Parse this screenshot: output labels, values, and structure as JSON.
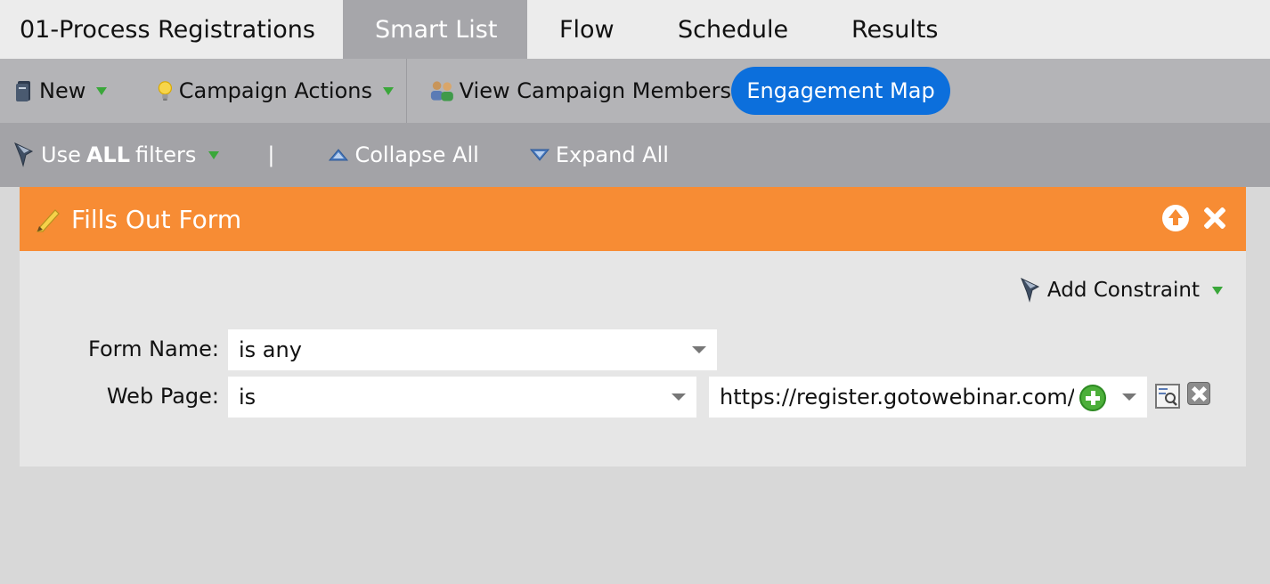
{
  "tabs": [
    {
      "label": "01-Process Registrations"
    },
    {
      "label": "Smart List",
      "active": true
    },
    {
      "label": "Flow"
    },
    {
      "label": "Schedule"
    },
    {
      "label": "Results"
    }
  ],
  "toolbar": {
    "new_label": "New",
    "campaign_actions_label": "Campaign Actions",
    "view_members_label": "View Campaign Members",
    "engagement_map_label": "Engagement Map"
  },
  "filterbar": {
    "use_prefix": "Use",
    "use_bold": "ALL",
    "use_suffix": "filters",
    "divider": "|",
    "collapse_label": "Collapse All",
    "expand_label": "Expand All"
  },
  "filter": {
    "title": "Fills Out Form",
    "add_constraint_label": "Add Constraint",
    "rows": [
      {
        "label": "Form Name:",
        "operator": "is any"
      },
      {
        "label": "Web Page:",
        "operator": "is",
        "value": "https://register.gotowebinar.com/"
      }
    ]
  },
  "colors": {
    "header_orange": "#f78c34",
    "accent_blue": "#0c6fdc",
    "active_tab": "#a6a6aa"
  }
}
